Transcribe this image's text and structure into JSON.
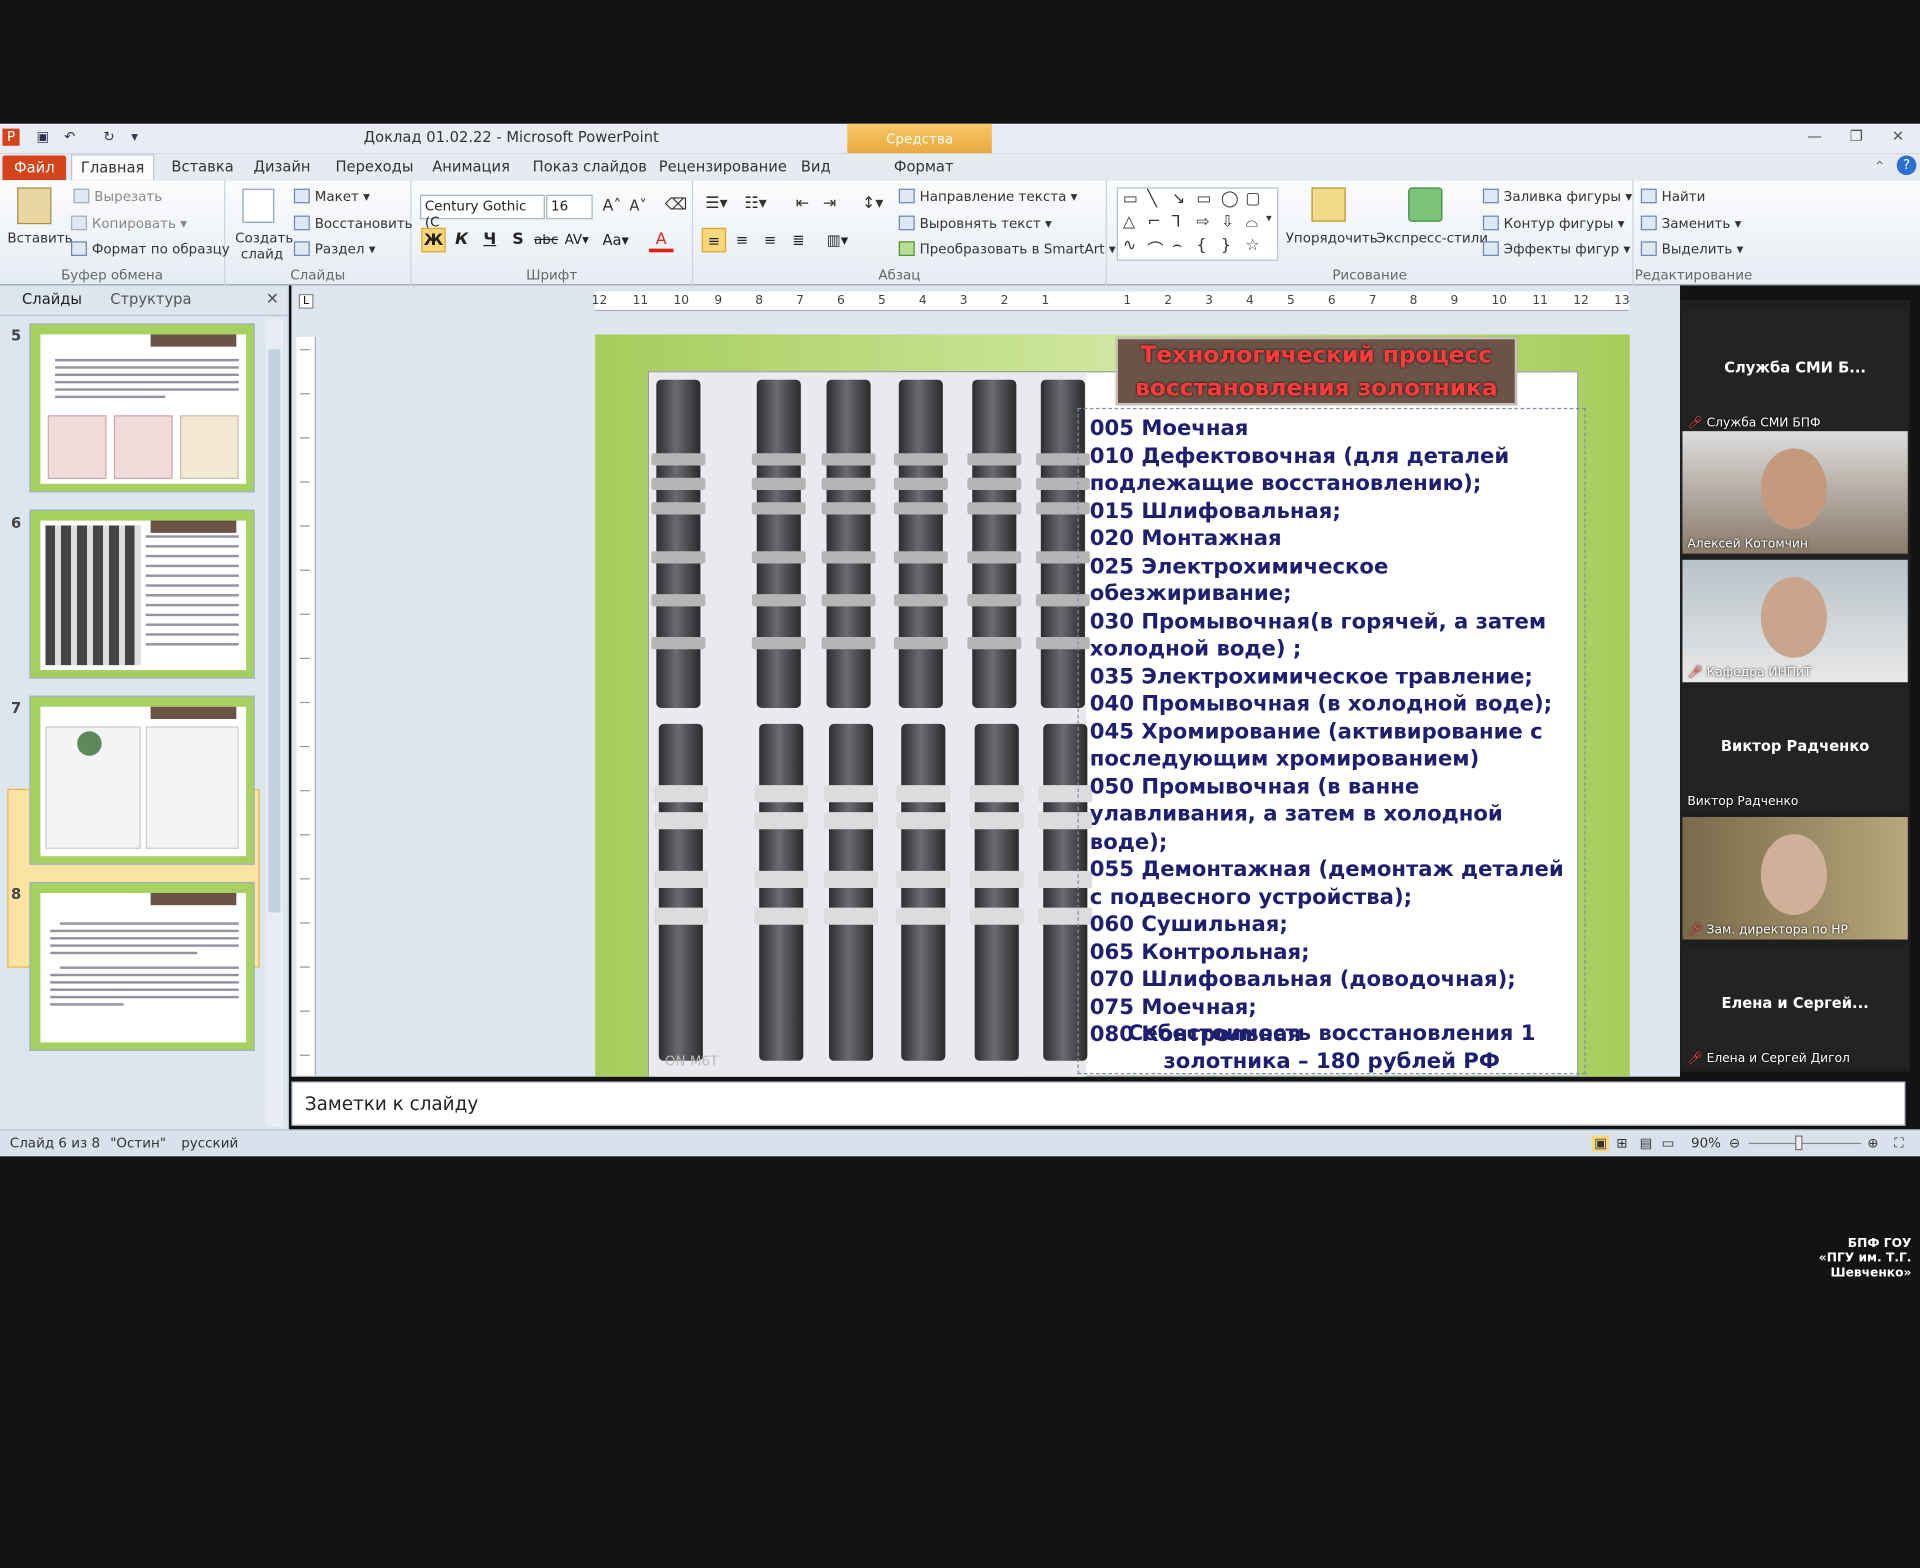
{
  "window": {
    "title": "Доклад 01.02.22 - Microsoft PowerPoint",
    "context_tab": "Средства рисования"
  },
  "tabs": [
    "Файл",
    "Главная",
    "Вставка",
    "Дизайн",
    "Переходы",
    "Анимация",
    "Показ слайдов",
    "Рецензирование",
    "Вид",
    "Формат"
  ],
  "ribbon": {
    "clipboard": {
      "paste": "Вставить",
      "cut": "Вырезать",
      "copy": "Копировать",
      "format_painter": "Формат по образцу",
      "label": "Буфер обмена"
    },
    "slides": {
      "new_slide": "Создать слайд",
      "layout": "Макет",
      "reset": "Восстановить",
      "section": "Раздел",
      "label": "Слайды"
    },
    "font": {
      "name": "Century Gothic (С",
      "size": "16",
      "label": "Шрифт"
    },
    "paragraph": {
      "label": "Абзац",
      "text_direction": "Направление текста",
      "align_text": "Выровнять текст",
      "smartart": "Преобразовать в SmartArt"
    },
    "drawing": {
      "arrange": "Упорядочить",
      "quick_styles": "Экспресс-стили",
      "shape_fill": "Заливка фигуры",
      "shape_outline": "Контур фигуры",
      "shape_effects": "Эффекты фигур",
      "label": "Рисование"
    },
    "editing": {
      "find": "Найти",
      "replace": "Заменить",
      "select": "Выделить",
      "label": "Редактирование"
    }
  },
  "left_pane": {
    "tab_slides": "Слайды",
    "tab_outline": "Структура",
    "close": "✕",
    "thumbnails": [
      "5",
      "6",
      "7",
      "8"
    ],
    "selected": "6"
  },
  "slide": {
    "title": "Технологический процесс восстановления золотника",
    "steps": [
      "005 Моечная",
      "010 Дефектовочная (для деталей подлежащие восстановлению);",
      "015 Шлифовальная;",
      "020 Монтажная",
      "025 Электрохимическое обезжиривание;",
      "030 Промывочная(в горячей, а затем холодной воде) ;",
      "035 Электрохимическое травление;",
      "040 Промывочная (в холодной воде);",
      "045 Хромирование (активирование с последующим хромированием)",
      "050 Промывочная (в ванне улавливания, а затем в холодной воде);",
      "055 Демонтажная (демонтаж деталей с подвесного устройства);",
      "060 Сушильная;",
      "065 Контрольная;",
      "070 Шлифовальная (доводочная);",
      "075 Моечная;",
      "080 Контрольная"
    ],
    "cost": "Себестоимость восстановления 1 золотника – 180 рублей РФ",
    "photo_watermark": "ON M6T"
  },
  "notes_placeholder": "Заметки к слайду",
  "status": {
    "slide": "Слайд 6 из 8",
    "theme": "\"Остин\"",
    "language": "русский",
    "zoom": "90%"
  },
  "participants": [
    {
      "name": "Служба СМИ Б...",
      "label": "Служба СМИ БПФ",
      "video": false,
      "muted": true
    },
    {
      "name": "",
      "label": "Алексей Котомчин",
      "video": true,
      "muted": false
    },
    {
      "name": "",
      "label": "Кафедра ИНПиТ",
      "video": true,
      "muted": true
    },
    {
      "name": "Виктор Радченко",
      "label": "Виктор Радченко",
      "video": false,
      "muted": false
    },
    {
      "name": "",
      "label": "Зам. директора по НР",
      "video": true,
      "muted": true
    },
    {
      "name": "Елена и Сергей...",
      "label": "Елена и Сергей Дигол",
      "video": false,
      "muted": true
    }
  ],
  "brand": {
    "line1": "БПФ ГОУ",
    "line2": "«ПГУ им. Т.Г. Шевченко»"
  },
  "colors": {
    "slide_title_text": "#ff3b3b",
    "slide_body_text": "#1e1f6e",
    "slide_bg": "#a5cd5c",
    "file_tab": "#d3441b"
  }
}
